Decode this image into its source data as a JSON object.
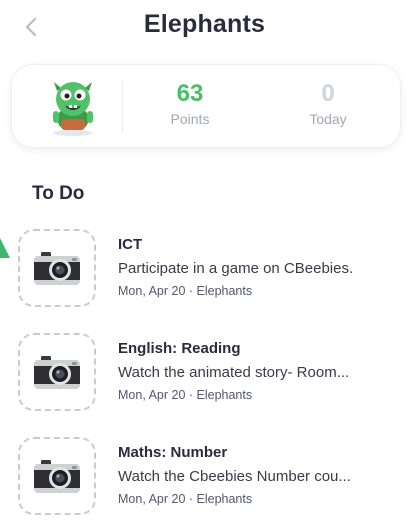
{
  "header": {
    "title": "Elephants",
    "back_icon": "chevron-left-icon"
  },
  "stats": {
    "avatar_icon": "green-monster-avatar",
    "points_value": "63",
    "points_label": "Points",
    "today_value": "0",
    "today_label": "Today",
    "colors": {
      "points": "#4cbd6a",
      "today": "#d0d2dc"
    }
  },
  "todo": {
    "title": "To Do",
    "tasks": [
      {
        "subject": "ICT",
        "description": "Participate in a game on CBeebies.",
        "meta": "Mon, Apr 20 · Elephants",
        "thumb_icon": "camera-icon"
      },
      {
        "subject": "English: Reading",
        "description": "Watch the animated story- Room...",
        "meta": "Mon, Apr 20 · Elephants",
        "thumb_icon": "camera-icon"
      },
      {
        "subject": "Maths: Number",
        "description": "Watch the Cbeebies Number cou...",
        "meta": "Mon, Apr 20 · Elephants",
        "thumb_icon": "camera-icon"
      }
    ]
  }
}
